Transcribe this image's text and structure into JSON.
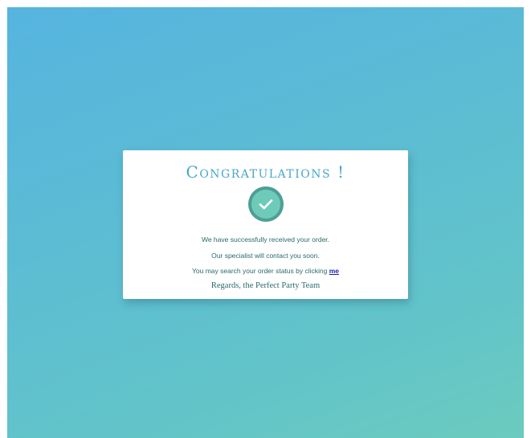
{
  "card": {
    "title": "Congratulations !",
    "icon": "check-circle-icon",
    "accent_color": "#4aa6c9",
    "icon_ring_color": "#4c9f95",
    "icon_fill_color": "#6fcbb9",
    "line1": "We have successfully received your order.",
    "line2": "Our specialist will contact you soon.",
    "line3_prefix": "You may search your order status by clicking ",
    "line3_link": "me",
    "signature": "Regards, the Perfect Party Team"
  },
  "background": {
    "gradient_start": "#56b4df",
    "gradient_end": "#6bcbbf"
  }
}
